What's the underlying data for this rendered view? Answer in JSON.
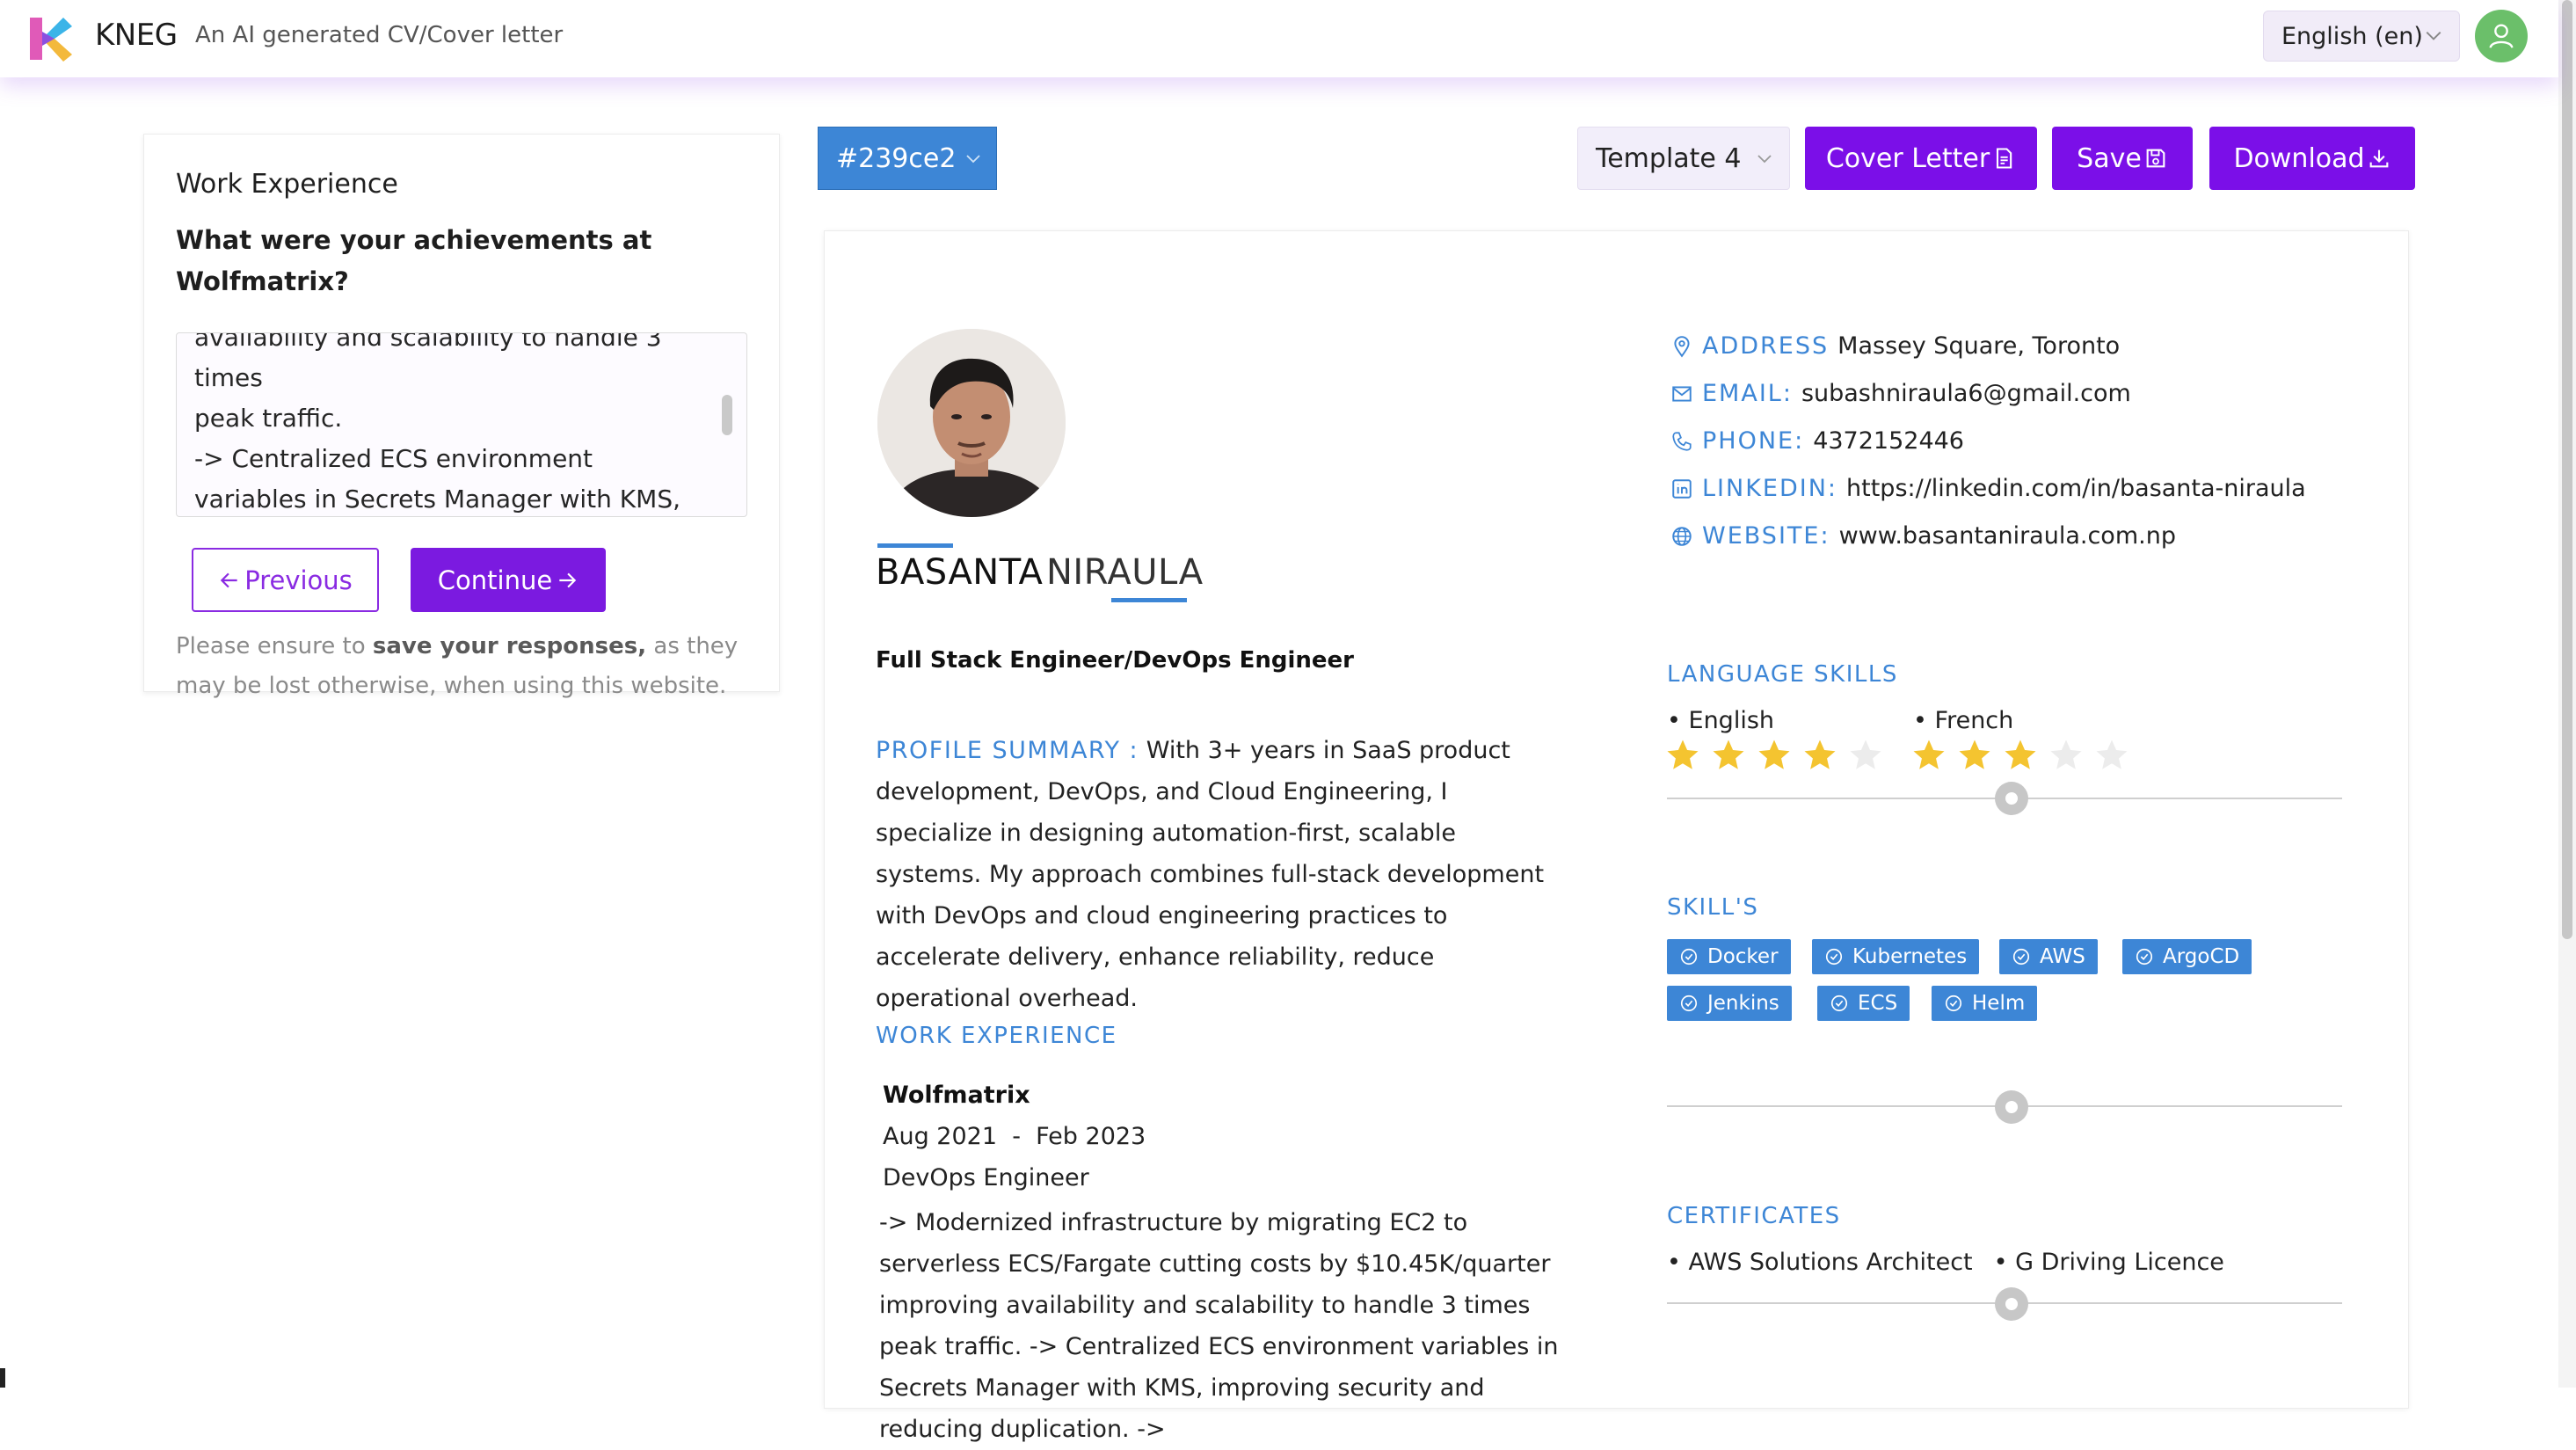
{
  "header": {
    "brand": "KNEG",
    "tagline": "An AI generated CV/Cover letter",
    "language": "English (en)"
  },
  "form": {
    "section_title": "Work Experience",
    "question": "What were your achievements at Wolfmatrix?",
    "answer": "availability and scalability to handle 3 times\npeak traffic.\n-> Centralized ECS environment variables in Secrets Manager with KMS, improving security and reducing duplication.\n-> Reduced the pipeline time by",
    "prev_label": "Previous",
    "continue_label": "Continue",
    "note_before": "Please ensure to ",
    "note_bold": "save your responses,",
    "note_after": " as they may be lost otherwise, when using this website."
  },
  "toolbar": {
    "color_value": "#239ce2",
    "template": "Template 4",
    "cover_letter": "Cover Letter",
    "save": "Save",
    "download": "Download"
  },
  "resume": {
    "first_name": "BASANTA",
    "last_name": "NIRAULA",
    "job_title": "Full Stack Engineer/DevOps Engineer",
    "summary_label": "PROFILE SUMMARY :",
    "summary": "With 3+ years in SaaS product development, DevOps, and Cloud Engineering, I specialize in designing automation-first, scalable systems. My approach combines full-stack development with DevOps and cloud engineering practices to accelerate delivery, enhance reliability, reduce operational overhead.",
    "work_heading": "WORK EXPERIENCE",
    "company": "Wolfmatrix",
    "start": "Aug 2021",
    "dash": "-",
    "end": "Feb 2023",
    "role": "DevOps Engineer",
    "description": "-> Modernized infrastructure by migrating EC2 to serverless ECS/Fargate cutting costs by $10.45K/quarter improving availability and scalability to handle 3 times peak traffic. -> Centralized ECS environment variables in Secrets Manager with KMS, improving security and reducing duplication. ->",
    "contact": {
      "address_label": "ADDRESS",
      "address": "Massey Square, Toronto",
      "email_label": "EMAIL:",
      "email": "subashniraula6@gmail.com",
      "phone_label": "PHONE:",
      "phone": "4372152446",
      "linkedin_label": "LINKEDIN:",
      "linkedin": "https://linkedin.com/in/basanta-niraula",
      "website_label": "WEBSITE:",
      "website": "www.basantaniraula.com.np"
    },
    "languages_heading": "LANGUAGE SKILLS",
    "languages": [
      {
        "name": "• English",
        "rating": 4,
        "max": 5
      },
      {
        "name": "• French",
        "rating": 3,
        "max": 5
      }
    ],
    "skills_heading": "SKILL'S",
    "skills": [
      "Docker",
      "Kubernetes",
      "AWS",
      "ArgoCD",
      "Jenkins",
      "ECS",
      "Helm"
    ],
    "certificates_heading": "CERTIFICATES",
    "certificates": [
      "• AWS Solutions Architect",
      "• G Driving Licence"
    ]
  },
  "colors": {
    "accent_purple": "#7b0fe8",
    "resume_blue": "#3d86d6",
    "star_gold": "#f4c430",
    "avatar_green": "#6bbf6a"
  },
  "icons": {
    "logo": "kneg-logo-icon",
    "user": "user-icon",
    "chevron": "chevron-down-icon",
    "cover_letter": "document-icon",
    "save": "floppy-disk-icon",
    "download": "download-icon",
    "previous": "arrow-left-icon",
    "continue": "arrow-right-icon",
    "address": "location-pin-icon",
    "email": "envelope-icon",
    "phone": "phone-icon",
    "linkedin": "linkedin-icon",
    "website": "globe-icon",
    "skill": "check-circle-icon",
    "star": "star-icon"
  }
}
